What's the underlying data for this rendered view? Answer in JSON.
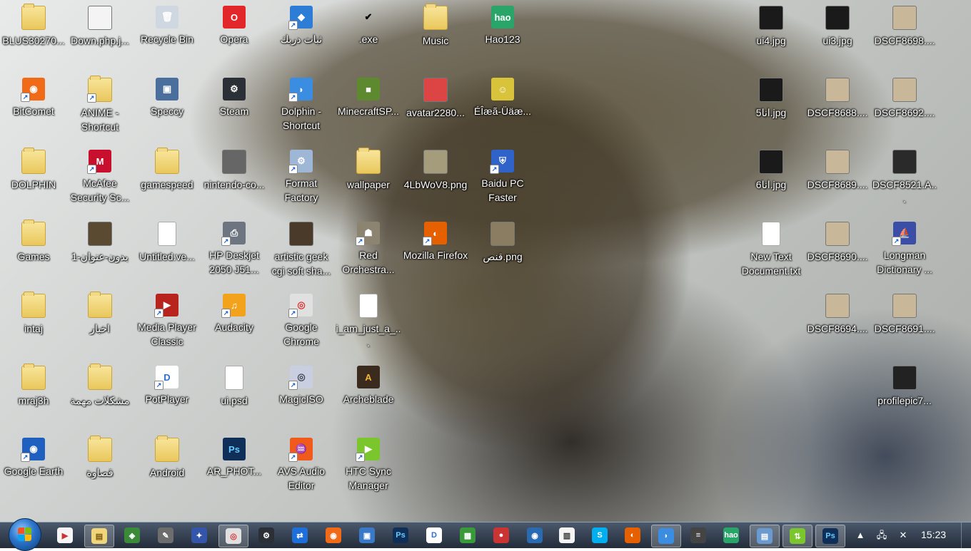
{
  "desktop_icons": [
    {
      "label": "BLUS30270...",
      "icon": "folder-icon",
      "kind": "folder"
    },
    {
      "label": "Down.php.j...",
      "icon": "image-file-icon",
      "kind": "pic",
      "color": "#f4f4f4"
    },
    {
      "label": "Recycle Bin",
      "icon": "recycle-bin-icon",
      "kind": "app",
      "color": "#cfd8e0",
      "glyph": "🗑"
    },
    {
      "label": "Opera",
      "icon": "opera-icon",
      "kind": "app",
      "color": "#e3262a",
      "glyph": "O"
    },
    {
      "label": "ثبات دربك",
      "icon": "shield-app-icon",
      "kind": "app",
      "color": "#2d7dd6",
      "glyph": "◆",
      "shortcut": true
    },
    {
      "label": ".exe",
      "icon": "checkmark-icon",
      "kind": "app",
      "color": "transparent",
      "glyph": "✔",
      "glyphColor": "#000"
    },
    {
      "label": "Music",
      "icon": "folder-icon",
      "kind": "folder"
    },
    {
      "label": "Hao123",
      "icon": "hao123-icon",
      "kind": "app",
      "color": "#2aa56a",
      "glyph": "hao"
    },
    {
      "label": "BitComet",
      "icon": "bitcomet-icon",
      "kind": "app",
      "color": "#f06a18",
      "glyph": "◉",
      "shortcut": true
    },
    {
      "label": "ANIME - Shortcut",
      "icon": "folder-icon",
      "kind": "folder",
      "shortcut": true
    },
    {
      "label": "Speccy",
      "icon": "speccy-icon",
      "kind": "app",
      "color": "#4a6f9d",
      "glyph": "▣"
    },
    {
      "label": "Steam",
      "icon": "steam-icon",
      "kind": "app",
      "color": "#2b2f36",
      "glyph": "⚙"
    },
    {
      "label": "Dolphin - Shortcut",
      "icon": "dolphin-icon",
      "kind": "app",
      "color": "#3a8de0",
      "glyph": "◗",
      "shortcut": true
    },
    {
      "label": "MinecraftSP...",
      "icon": "minecraft-icon",
      "kind": "app",
      "color": "#5d8a2e",
      "glyph": "■"
    },
    {
      "label": "avatar2280...",
      "icon": "image-file-icon",
      "kind": "pic",
      "color": "#d44"
    },
    {
      "label": "ÉÎæã-Üäæ...",
      "icon": "smiley-icon",
      "kind": "app",
      "color": "#d8c33a",
      "glyph": "☺"
    },
    {
      "label": "DOLPHIN",
      "icon": "folder-icon",
      "kind": "folder"
    },
    {
      "label": "McAfee Security Sc...",
      "icon": "mcafee-icon",
      "kind": "app",
      "color": "#c8102e",
      "glyph": "M",
      "shortcut": true
    },
    {
      "label": "gamespeed",
      "icon": "folder-icon",
      "kind": "folder"
    },
    {
      "label": "nintendo-co...",
      "icon": "image-file-icon",
      "kind": "pic",
      "color": "#666"
    },
    {
      "label": "Format Factory",
      "icon": "format-factory-icon",
      "kind": "app",
      "color": "#9fb7d6",
      "glyph": "⚙",
      "shortcut": true
    },
    {
      "label": "wallpaper",
      "icon": "folder-icon",
      "kind": "folder"
    },
    {
      "label": "4LbWoV8.png",
      "icon": "image-file-icon",
      "kind": "pic",
      "color": "#a59c7c"
    },
    {
      "label": "Baidu PC Faster",
      "icon": "baidu-shield-icon",
      "kind": "app",
      "color": "#2f63c9",
      "glyph": "⛨",
      "shortcut": true
    },
    {
      "label": "Games",
      "icon": "folder-icon",
      "kind": "folder"
    },
    {
      "label": "1-بدون-عنوان",
      "icon": "image-file-icon",
      "kind": "pic",
      "color": "#5a4a32"
    },
    {
      "label": "Untitled.ve...",
      "icon": "document-icon",
      "kind": "doc"
    },
    {
      "label": "HP Deskjet 2050 J51...",
      "icon": "printer-icon",
      "kind": "app",
      "color": "#6d7680",
      "glyph": "⎙",
      "shortcut": true
    },
    {
      "label": "artistic geek cgi soft sha...",
      "icon": "image-file-icon",
      "kind": "pic",
      "color": "#4a3a2a"
    },
    {
      "label": "Red Orchestra...",
      "icon": "red-orchestra-icon",
      "kind": "app",
      "color": "#8c8470",
      "glyph": "☗",
      "shortcut": true
    },
    {
      "label": "Mozilla Firefox",
      "icon": "firefox-icon",
      "kind": "app",
      "color": "#e66000",
      "glyph": "◐",
      "shortcut": true
    },
    {
      "label": "قنص.png",
      "icon": "image-file-icon",
      "kind": "pic",
      "color": "#8a7d62"
    },
    {
      "label": "intaj",
      "icon": "folder-icon",
      "kind": "folder"
    },
    {
      "label": "اخبار",
      "icon": "folder-icon",
      "kind": "folder"
    },
    {
      "label": "Media Player Classic",
      "icon": "media-player-classic-icon",
      "kind": "app",
      "color": "#b8231e",
      "glyph": "▶",
      "shortcut": true
    },
    {
      "label": "Audacity",
      "icon": "audacity-icon",
      "kind": "app",
      "color": "#f2a31b",
      "glyph": "♫",
      "shortcut": true
    },
    {
      "label": "Google Chrome",
      "icon": "chrome-icon",
      "kind": "app",
      "color": "#e0e0e0",
      "glyph": "◎",
      "glyphColor": "#d33",
      "shortcut": true
    },
    {
      "label": "i_am_just_a_...",
      "icon": "document-icon",
      "kind": "doc"
    },
    null,
    null,
    {
      "label": "mraj3h",
      "icon": "folder-icon",
      "kind": "folder"
    },
    {
      "label": "مشكلات مهمة",
      "icon": "folder-icon",
      "kind": "folder"
    },
    {
      "label": "PotPlayer",
      "icon": "potplayer-icon",
      "kind": "app",
      "color": "#fff",
      "glyph": "D",
      "glyphColor": "#2b6fd9",
      "shortcut": true
    },
    {
      "label": "ui.psd",
      "icon": "document-icon",
      "kind": "doc"
    },
    {
      "label": "MagicISO",
      "icon": "magiciso-icon",
      "kind": "app",
      "color": "#c9cfe0",
      "glyph": "◎",
      "glyphColor": "#445",
      "shortcut": true
    },
    {
      "label": "Archeblade",
      "icon": "archeblade-icon",
      "kind": "app",
      "color": "#3b2b1f",
      "glyph": "A",
      "glyphColor": "#f2b43a"
    },
    null,
    null,
    {
      "label": "Google Earth",
      "icon": "google-earth-icon",
      "kind": "app",
      "color": "#1f5fbf",
      "glyph": "◉",
      "shortcut": true
    },
    {
      "label": "قصاوة",
      "icon": "folder-icon",
      "kind": "folder"
    },
    {
      "label": "Android",
      "icon": "folder-icon",
      "kind": "folder"
    },
    {
      "label": "AR_PHOT...",
      "icon": "photoshop-icon",
      "kind": "app",
      "color": "#0f2f58",
      "glyph": "Ps",
      "glyphColor": "#6cf"
    },
    {
      "label": "AVS Audio Editor",
      "icon": "avs-audio-icon",
      "kind": "app",
      "color": "#f05a1a",
      "glyph": "♒",
      "shortcut": true
    },
    {
      "label": "HTC Sync Manager",
      "icon": "htc-sync-icon",
      "kind": "app",
      "color": "#7bc62d",
      "glyph": "▶",
      "shortcut": true
    },
    null,
    null
  ],
  "right_icons": [
    {
      "label": "ui4.jpg",
      "icon": "image-file-icon",
      "kind": "pic",
      "color": "#1a1a1a"
    },
    {
      "label": "ui3.jpg",
      "icon": "image-file-icon",
      "kind": "pic",
      "color": "#1a1a1a"
    },
    {
      "label": "DSCF8698....",
      "icon": "image-file-icon",
      "kind": "pic",
      "color": "#c9b79a"
    },
    {
      "label": "انا5.jpg",
      "icon": "image-file-icon",
      "kind": "pic",
      "color": "#1a1a1a"
    },
    {
      "label": "DSCF8688....",
      "icon": "image-file-icon",
      "kind": "pic",
      "color": "#c9b79a"
    },
    {
      "label": "DSCF8692....",
      "icon": "image-file-icon",
      "kind": "pic",
      "color": "#c9b79a"
    },
    {
      "label": "انا6.jpg",
      "icon": "image-file-icon",
      "kind": "pic",
      "color": "#1a1a1a"
    },
    {
      "label": "DSCF8689....",
      "icon": "image-file-icon",
      "kind": "pic",
      "color": "#c9b79a"
    },
    {
      "label": "DSCF8521.A...",
      "icon": "video-file-icon",
      "kind": "pic",
      "color": "#2a2a2a"
    },
    {
      "label": "New Text Document.txt",
      "icon": "text-document-icon",
      "kind": "doc"
    },
    {
      "label": "DSCF8690....",
      "icon": "image-file-icon",
      "kind": "pic",
      "color": "#c9b79a"
    },
    {
      "label": "Longman Dictionary ...",
      "icon": "longman-icon",
      "kind": "app",
      "color": "#3a4ea8",
      "glyph": "⛵",
      "shortcut": true
    },
    null,
    {
      "label": "DSCF8694....",
      "icon": "image-file-icon",
      "kind": "pic",
      "color": "#c9b79a"
    },
    {
      "label": "DSCF8691....",
      "icon": "image-file-icon",
      "kind": "pic",
      "color": "#c9b79a"
    },
    null,
    null,
    {
      "label": "profilepic7...",
      "icon": "image-file-icon",
      "kind": "pic",
      "color": "#222"
    }
  ],
  "taskbar": {
    "pinned": [
      {
        "name": "media-player-icon",
        "color": "#f5f5f5",
        "glyph": "▶",
        "glyphColor": "#c33"
      },
      {
        "name": "explorer-icon",
        "color": "#f0d57a",
        "glyph": "▤",
        "glyphColor": "#7a5a10",
        "active": true
      },
      {
        "name": "network-globe-icon",
        "color": "#3a8a3a",
        "glyph": "◈"
      },
      {
        "name": "tools-icon",
        "color": "#6d6d6d",
        "glyph": "✎"
      },
      {
        "name": "tweak-icon",
        "color": "#3355aa",
        "glyph": "✦"
      },
      {
        "name": "chrome-icon",
        "color": "#e0e0e0",
        "glyph": "◎",
        "glyphColor": "#d33",
        "active": true
      },
      {
        "name": "steam-icon",
        "color": "#2b2f36",
        "glyph": "⚙"
      },
      {
        "name": "teamviewer-icon",
        "color": "#1e6fd9",
        "glyph": "⇄"
      },
      {
        "name": "bitcomet-icon",
        "color": "#f06a18",
        "glyph": "◉"
      },
      {
        "name": "remote-desktop-icon",
        "color": "#3a78c8",
        "glyph": "▣"
      },
      {
        "name": "photoshop-icon",
        "color": "#0f2f58",
        "glyph": "Ps",
        "glyphColor": "#6cf"
      },
      {
        "name": "potplayer-icon",
        "color": "#fff",
        "glyph": "D",
        "glyphColor": "#2b6fd9"
      },
      {
        "name": "photos-icon",
        "color": "#3a9a3a",
        "glyph": "▦"
      },
      {
        "name": "recorder-icon",
        "color": "#c33",
        "glyph": "●"
      },
      {
        "name": "camera-icon",
        "color": "#2a6ab0",
        "glyph": "◉"
      },
      {
        "name": "calendar-icon",
        "color": "#f4f4f4",
        "glyph": "▥",
        "glyphColor": "#333"
      },
      {
        "name": "skype-icon",
        "color": "#00aff0",
        "glyph": "S"
      },
      {
        "name": "firefox-icon",
        "color": "#e66000",
        "glyph": "◐"
      },
      {
        "name": "dolphin-icon",
        "color": "#3a8de0",
        "glyph": "◗",
        "active": true
      },
      {
        "name": "flag-icon",
        "color": "#444",
        "glyph": "≡"
      },
      {
        "name": "hao123-icon",
        "color": "#2aa56a",
        "glyph": "hao"
      },
      {
        "name": "control-panel-icon",
        "color": "#6a9ad0",
        "glyph": "▤",
        "active": true
      },
      {
        "name": "htc-sync-icon",
        "color": "#7bc62d",
        "glyph": "⇅",
        "active": true
      },
      {
        "name": "photoshop-icon",
        "color": "#0f2f58",
        "glyph": "Ps",
        "glyphColor": "#6cf",
        "active": true
      }
    ],
    "clock": "15:23"
  }
}
